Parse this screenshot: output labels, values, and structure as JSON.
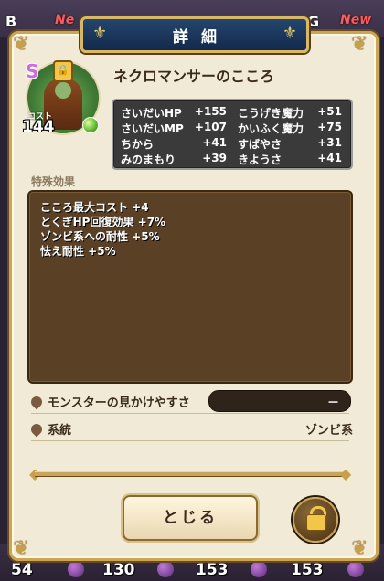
{
  "background": {
    "tags": [
      "B",
      "G"
    ],
    "new_labels": [
      "Ne",
      "New"
    ],
    "bottom_numbers": [
      "54",
      "130",
      "153",
      "153"
    ]
  },
  "header": {
    "title": "詳細"
  },
  "heart": {
    "rank": "S",
    "name": "ネクロマンサーのこころ",
    "cost_label": "コスト",
    "cost": "144"
  },
  "stats": [
    {
      "name": "さいだいHP",
      "value": "+155"
    },
    {
      "name": "こうげき魔力",
      "value": "+51"
    },
    {
      "name": "さいだいMP",
      "value": "+107"
    },
    {
      "name": "かいふく魔力",
      "value": "+75"
    },
    {
      "name": "ちから",
      "value": "+41"
    },
    {
      "name": "すばやさ",
      "value": "+31"
    },
    {
      "name": "みのまもり",
      "value": "+39"
    },
    {
      "name": "きようさ",
      "value": "+41"
    }
  ],
  "effects": {
    "label": "特殊効果",
    "lines": [
      "こころ最大コスト +4",
      "とくぎHP回復効果 +7%",
      "ゾンビ系への耐性 +5%",
      "怯え耐性 +5%"
    ]
  },
  "looks": {
    "label": "モンスターの見かけやすさ",
    "value": "－"
  },
  "family": {
    "label": "系統",
    "value": "ゾンビ系"
  },
  "buttons": {
    "close": "とじる"
  },
  "colors": {
    "banner": "#1d3a60",
    "panel": "#f1ead6",
    "effects_bg": "#5a4126"
  },
  "icons": [
    "lock-icon",
    "green-orb-icon",
    "drop-icon",
    "ornament-icon"
  ]
}
